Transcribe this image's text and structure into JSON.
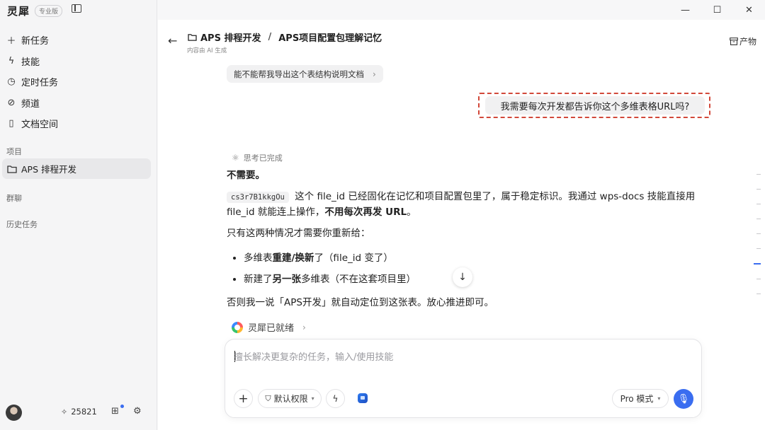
{
  "app": {
    "brand": "灵犀",
    "edition_tag": "专业版"
  },
  "window_controls": {
    "minimize": "—",
    "maximize": "☐",
    "close": "✕"
  },
  "sidebar": {
    "nav": [
      {
        "icon": "plus-icon",
        "glyph": "＋",
        "label": "新任务"
      },
      {
        "icon": "bolt-icon",
        "glyph": "ϟ",
        "label": "技能"
      },
      {
        "icon": "clock-icon",
        "glyph": "◷",
        "label": "定时任务"
      },
      {
        "icon": "channel-icon",
        "glyph": "⊘",
        "label": "频道"
      },
      {
        "icon": "doc-icon",
        "glyph": "▯",
        "label": "文档空间"
      }
    ],
    "section_projects": "项目",
    "project_active": "APS 排程开发",
    "section_groups": "群聊",
    "section_history": "历史任务",
    "bottom": {
      "credits": "25821",
      "credits_icon": "spark-icon",
      "gift_icon": "gift-icon",
      "settings_icon": "gear-icon"
    }
  },
  "header": {
    "project": "APS 排程开发",
    "separator": "/",
    "conversation_title": "APS项目配置包理解记忆",
    "ai_note": "内容由 AI 生成",
    "artifacts_label": "产物"
  },
  "chat": {
    "suggestion": "能不能帮我导出这个表结构说明文档",
    "user_message": "我需要每次开发都告诉你这个多维表格URL吗?",
    "thinking_status": "思考已完成",
    "answer": {
      "p1": "不需要。",
      "code_id": "cs3r7B1kkgOu",
      "p2_a": "这个 file_id 已经固化在记忆和项目配置包里了，属于稳定标识。我通过 wps-docs 技能直接用 file_id 就能连上操作，",
      "p2_bold": "不用每次再发 URL",
      "p2_end": "。",
      "p3": "只有这两种情况才需要你重新给：",
      "b1_a": "多维表",
      "b1_bold": "重建/换新",
      "b1_b": "了（file_id 变了）",
      "b2_a": "新建了",
      "b2_bold": "另一张",
      "b2_b": "多维表（不在这套项目里）",
      "p4": "否则我一说「APS开发」就自动定位到这张表。放心推进即可。"
    },
    "agent_status": "灵犀已就绪"
  },
  "composer": {
    "placeholder": "擅长解决更复杂的任务，输入/使用技能",
    "permission_label": "默认权限",
    "mode_label": "Pro 模式"
  },
  "colors": {
    "accent": "#3a6df0",
    "highlight_border": "#d2483a"
  }
}
